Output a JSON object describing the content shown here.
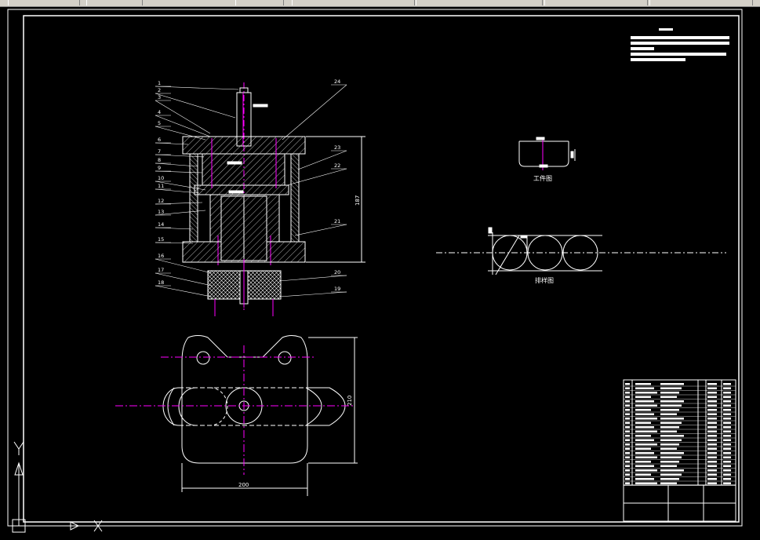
{
  "colors": {
    "background": "#000000",
    "frame": "#ffffff",
    "magenta": "#ff00ff",
    "centerline": "#ff00ff",
    "toolbar": "#d4d0c8"
  },
  "callouts_left": [
    "1",
    "2",
    "3",
    "4",
    "5",
    "6",
    "7",
    "8",
    "9",
    "10",
    "11",
    "12",
    "13",
    "14",
    "15",
    "16",
    "17",
    "18"
  ],
  "callouts_right": [
    "24",
    "23",
    "22",
    "21",
    "20",
    "19"
  ],
  "dimensions": {
    "height_187": "187",
    "width_200": "200",
    "height_210": "210"
  },
  "labels": {
    "workpiece": "工件图",
    "layout": "排样图"
  },
  "icons": {
    "ucs": "ucs-axis-icon",
    "cursor": "crosshair-icon"
  }
}
